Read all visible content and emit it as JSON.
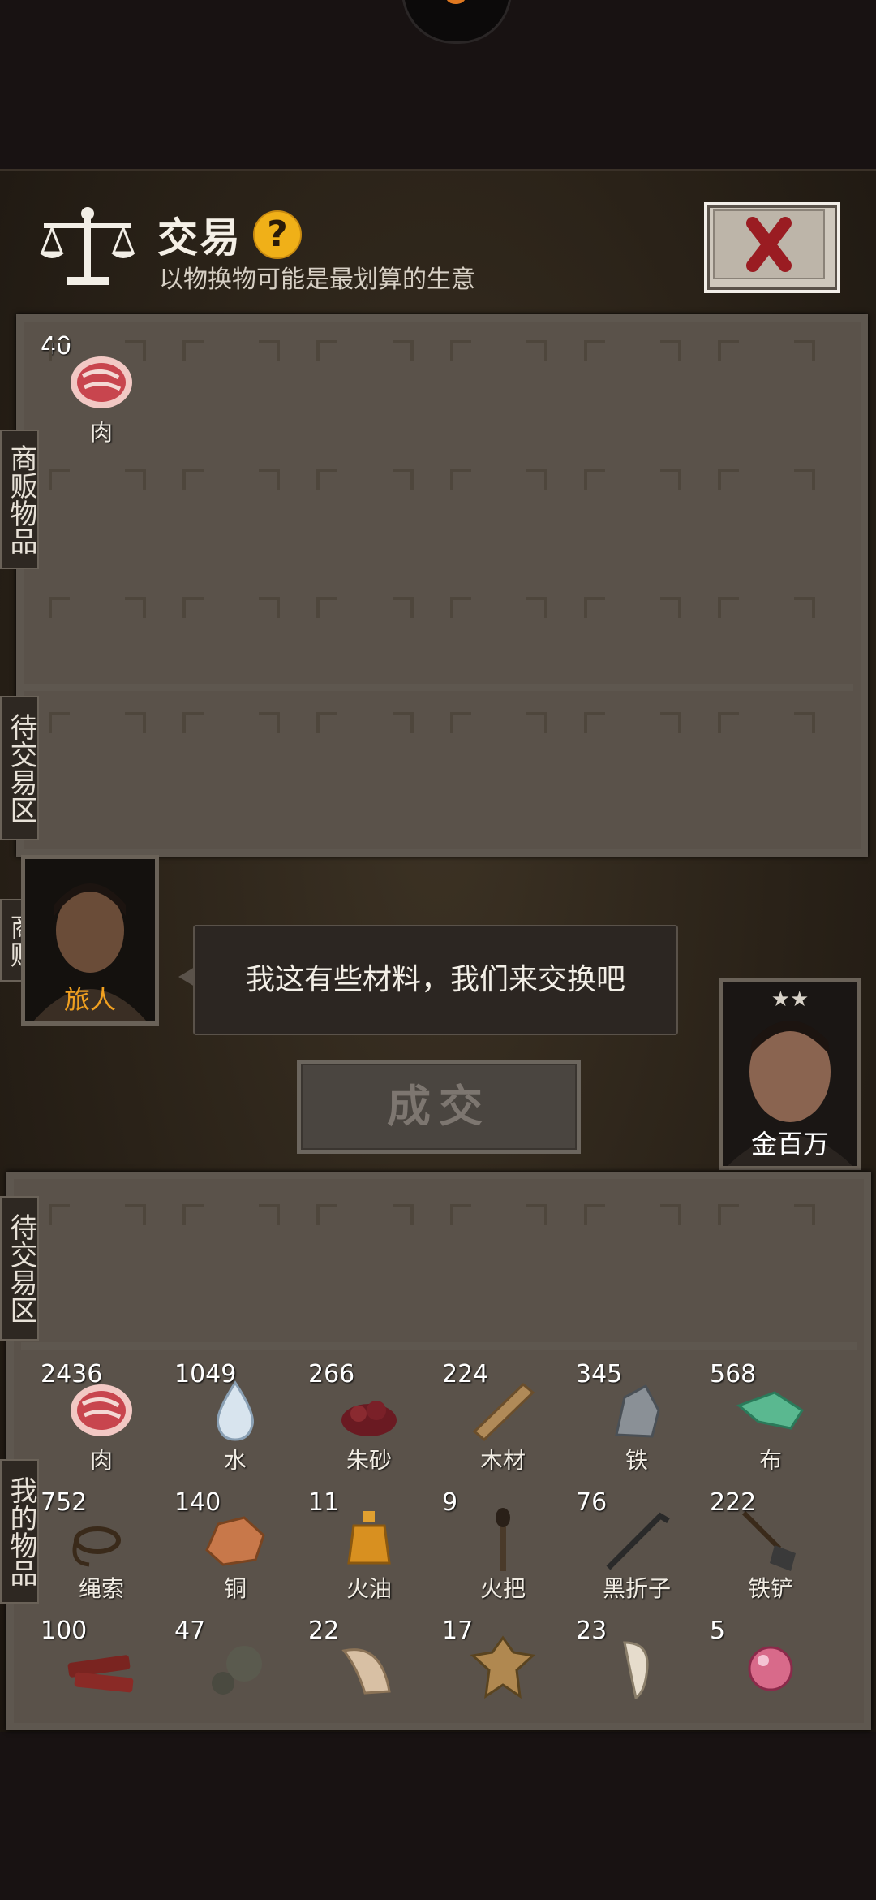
{
  "header": {
    "title": "交易",
    "subtitle": "以物换物可能是最划算的生意",
    "help_glyph": "?"
  },
  "labels": {
    "merchant_goods": "商贩物品",
    "merchant_pending": "待交易区",
    "merchant": "商贩",
    "my_pending": "待交易区",
    "my_goods": "我的物品"
  },
  "merchant": {
    "name": "旅人",
    "dialogue": "我这有些材料，我们来交换吧"
  },
  "player": {
    "name": "金百万",
    "stars": "★★"
  },
  "deal_button": "成交",
  "merchant_items": [
    {
      "count": "40",
      "name": "肉",
      "icon": "meat-icon"
    }
  ],
  "my_items": [
    {
      "count": "2436",
      "name": "肉",
      "icon": "meat-icon"
    },
    {
      "count": "1049",
      "name": "水",
      "icon": "water-drop-icon"
    },
    {
      "count": "266",
      "name": "朱砂",
      "icon": "cinnabar-icon"
    },
    {
      "count": "224",
      "name": "木材",
      "icon": "wood-plank-icon"
    },
    {
      "count": "345",
      "name": "铁",
      "icon": "iron-ore-icon"
    },
    {
      "count": "568",
      "name": "布",
      "icon": "cloth-icon"
    },
    {
      "count": "752",
      "name": "绳索",
      "icon": "rope-icon"
    },
    {
      "count": "140",
      "name": "铜",
      "icon": "copper-ore-icon"
    },
    {
      "count": "11",
      "name": "火油",
      "icon": "oil-bottle-icon"
    },
    {
      "count": "9",
      "name": "火把",
      "icon": "torch-icon"
    },
    {
      "count": "76",
      "name": "黑折子",
      "icon": "crowbar-icon"
    },
    {
      "count": "222",
      "name": "铁铲",
      "icon": "shovel-icon"
    },
    {
      "count": "100",
      "name": "",
      "icon": "jerky-icon"
    },
    {
      "count": "47",
      "name": "",
      "icon": "gourd-icon"
    },
    {
      "count": "22",
      "name": "",
      "icon": "horn-icon"
    },
    {
      "count": "17",
      "name": "",
      "icon": "hide-icon"
    },
    {
      "count": "23",
      "name": "",
      "icon": "tooth-icon"
    },
    {
      "count": "5",
      "name": "",
      "icon": "pearl-icon"
    }
  ]
}
